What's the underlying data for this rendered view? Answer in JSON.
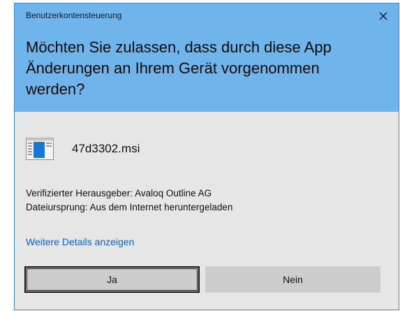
{
  "dialog": {
    "title": "Benutzerkontensteuerung",
    "question": "Möchten Sie zulassen, dass durch diese App Änderungen an Ihrem Gerät vorgenommen werden?",
    "file_name": "47d3302.msi",
    "publisher_line": "Verifizierter Herausgeber: Avaloq Outline AG",
    "origin_line": "Dateiursprung: Aus dem Internet heruntergeladen",
    "details_link": "Weitere Details anzeigen",
    "yes_label": "Ja",
    "no_label": "Nein"
  },
  "colors": {
    "header": "#6fb5ec",
    "body": "#e6e6e6",
    "link": "#0b63c6",
    "button": "#cdcdcd"
  },
  "icons": {
    "close": "close-icon",
    "file": "installer-file-icon"
  }
}
